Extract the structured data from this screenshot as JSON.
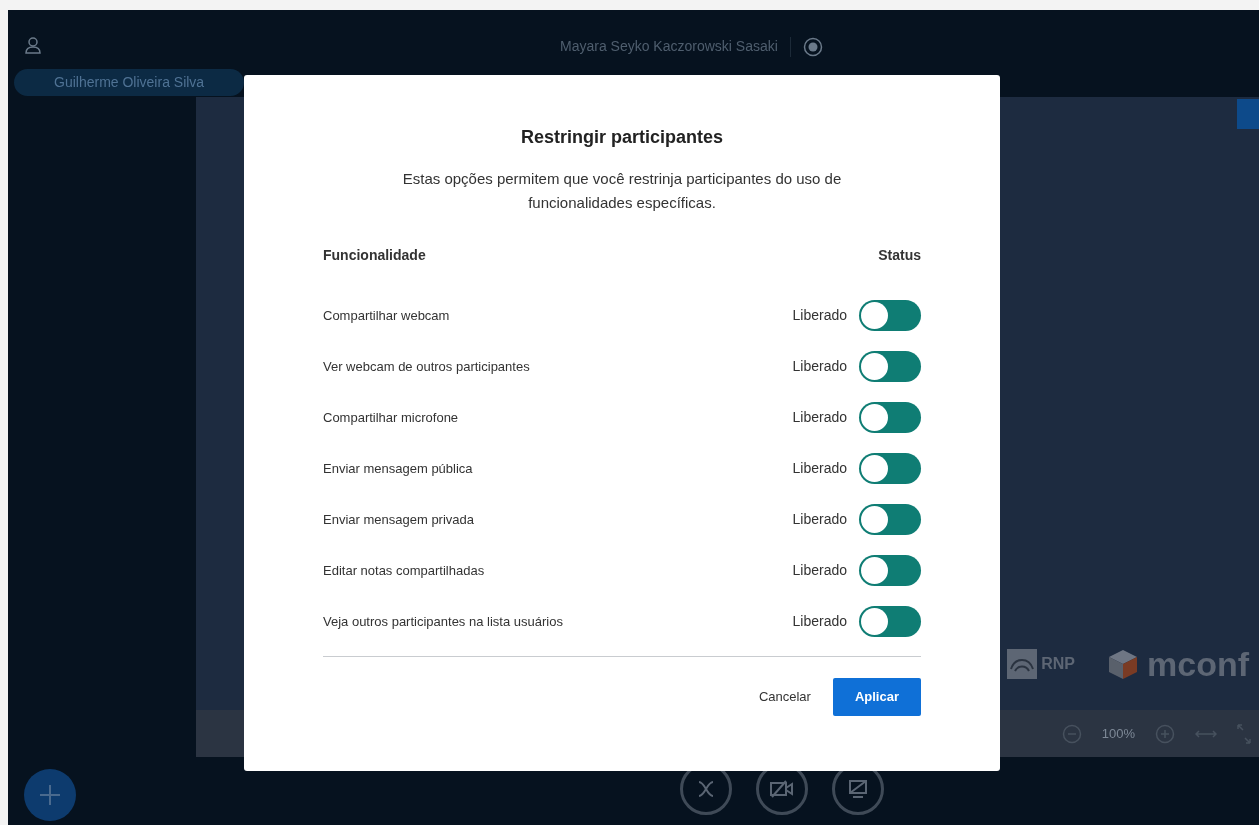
{
  "top_bar": {
    "title": "Mayara Seyko Kaczorowski Sasaki"
  },
  "user_list": {
    "items": [
      {
        "name": "Guilherme Oliveira Silva"
      }
    ]
  },
  "presentation": {
    "logos": [
      "RNP",
      "mconf"
    ],
    "zoom": "100%"
  },
  "dialog": {
    "title": "Restringir participantes",
    "description": "Estas opções permitem que você restrinja participantes do uso de funcionalidades específicas.",
    "columns": [
      "Funcionalidade",
      "Status"
    ],
    "rows": [
      {
        "label": "Compartilhar webcam",
        "status": "Liberado",
        "locked": false
      },
      {
        "label": "Ver webcam de outros participantes",
        "status": "Liberado",
        "locked": false
      },
      {
        "label": "Compartilhar microfone",
        "status": "Liberado",
        "locked": false
      },
      {
        "label": "Enviar mensagem pública",
        "status": "Liberado",
        "locked": false
      },
      {
        "label": "Enviar mensagem privada",
        "status": "Liberado",
        "locked": false
      },
      {
        "label": "Editar notas compartilhadas",
        "status": "Liberado",
        "locked": false
      },
      {
        "label": "Veja outros participantes na lista usuários",
        "status": "Liberado",
        "locked": false
      }
    ],
    "buttons": [
      {
        "label": "Cancelar",
        "kind": "secondary"
      },
      {
        "label": "Aplicar",
        "kind": "primary"
      }
    ]
  }
}
